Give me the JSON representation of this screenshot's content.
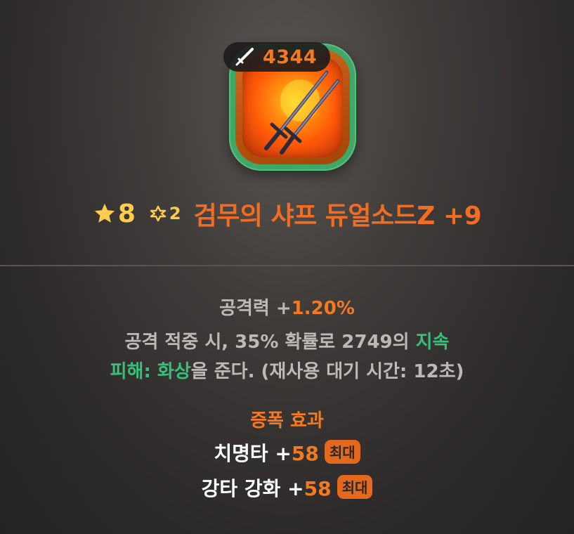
{
  "item": {
    "power_value": "4344",
    "star_grade": "8",
    "awaken_level": "2",
    "name": "검무의 샤프 듀얼소드Z +9",
    "icon_name": "dual-swords-icon"
  },
  "stats": {
    "attack_label": "공격력 +",
    "attack_value": "1.20%",
    "effect_line1_prefix": "공격 적중 시, 35% 확률로 2749의 ",
    "effect_line1_highlight": "지속",
    "effect_line2_highlight1": "피해: 화상",
    "effect_line2_suffix": "을 준다. (재사용 대기 시간: 12초)"
  },
  "amplify": {
    "heading": "증폭 효과",
    "items": [
      {
        "label": "치명타 +",
        "value": "58",
        "badge": "최대"
      },
      {
        "label": "강타 강화 +",
        "value": "58",
        "badge": "최대"
      }
    ]
  },
  "colors": {
    "accent_orange": "#f27a22",
    "highlight_green": "#36c07a",
    "star_yellow": "#ffcc4d",
    "frame_green": "#3fa868"
  }
}
